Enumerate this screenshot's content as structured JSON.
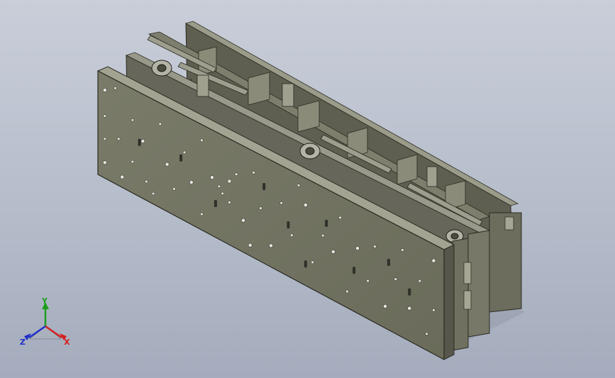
{
  "viewport": {
    "background_top": "#c9ced9",
    "background_bottom": "#a4acbd",
    "model_color": "#6f705f",
    "model_edge_color": "#2a2a22"
  },
  "triad": {
    "x_label": "X",
    "y_label": "Y",
    "z_label": "Z",
    "x_color": "#d42020",
    "y_color": "#1d9e1d",
    "z_color": "#2030c8"
  }
}
